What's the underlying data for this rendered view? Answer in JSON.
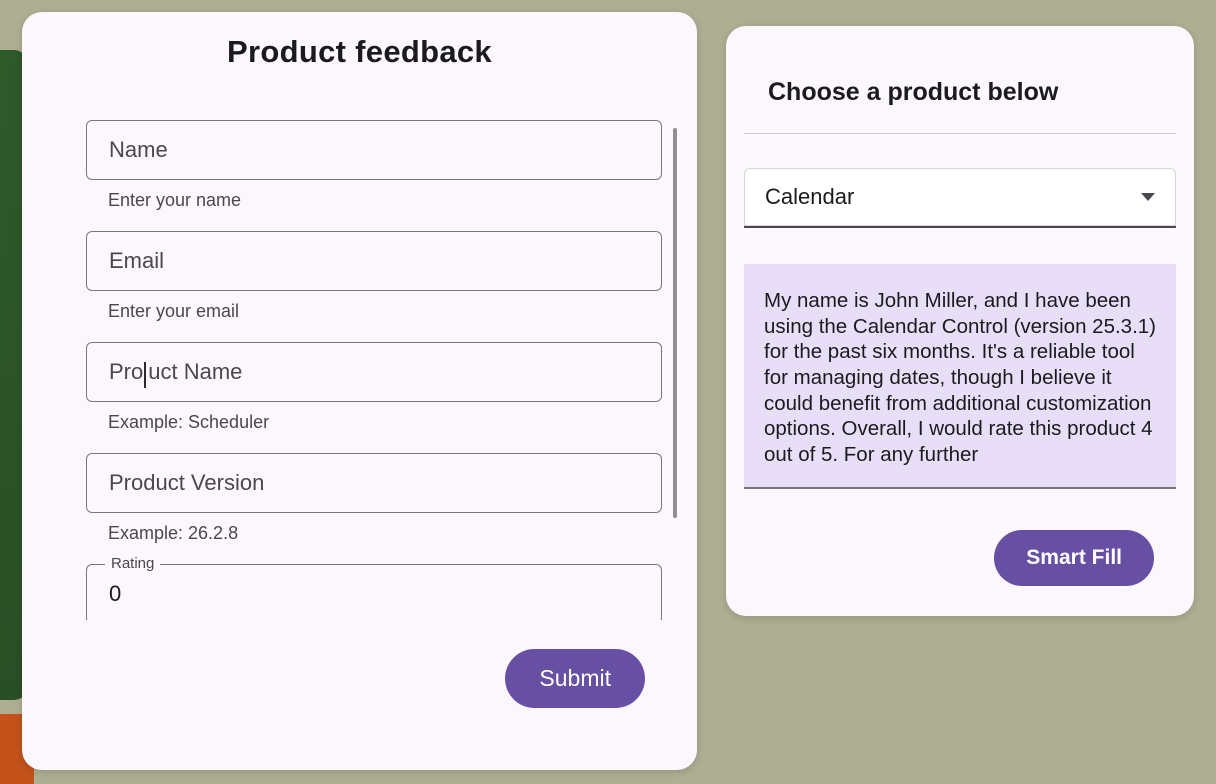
{
  "colors": {
    "accent": "#6750a4",
    "panel": "#fbf7fd",
    "desc_bg": "#e8def8"
  },
  "left": {
    "title": "Product feedback",
    "fields": {
      "name": {
        "placeholder": "Name",
        "hint": "Enter your name"
      },
      "email": {
        "placeholder": "Email",
        "hint": "Enter your email"
      },
      "product": {
        "placeholder": "Product Name",
        "hint": "Example: Scheduler"
      },
      "version": {
        "placeholder": "Product Version",
        "hint": "Example: 26.2.8"
      },
      "rating": {
        "label": "Rating",
        "value": "0"
      }
    },
    "submit_label": "Submit"
  },
  "right": {
    "title": "Choose a product below",
    "dropdown_selected": "Calendar",
    "description": "My name is John Miller, and I have been using the Calendar Control (version 25.3.1) for the past six months. It's a reliable tool for managing dates, though I believe it could benefit from additional customization options. Overall, I would rate this product 4 out of 5. For any further",
    "smart_fill_label": "Smart Fill"
  }
}
